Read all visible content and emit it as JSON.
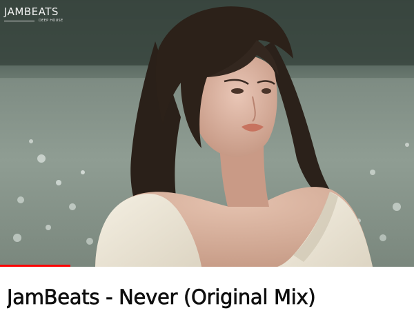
{
  "thumbnail": {
    "logo": {
      "wordmark": "JAMBEATS",
      "tagline": "DEEP HOUSE"
    },
    "watch_progress": 0.17,
    "progress_color": "#ff0000"
  },
  "video": {
    "title": "JamBeats - Never (Original Mix)"
  }
}
